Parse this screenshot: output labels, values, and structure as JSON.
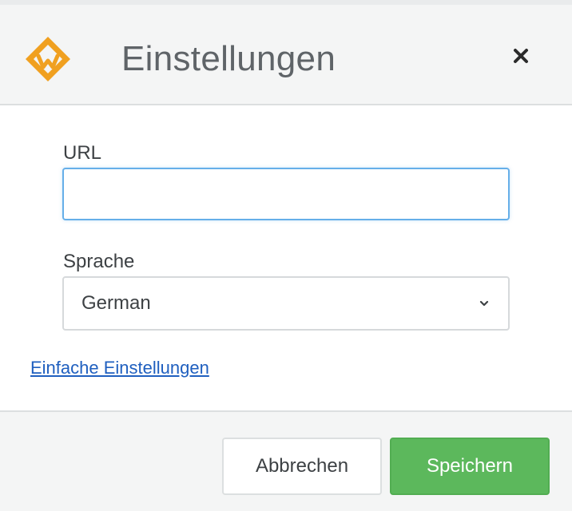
{
  "dialog": {
    "title": "Einstellungen",
    "logo_icon": "brand-logo-icon",
    "close_icon": "close-icon"
  },
  "form": {
    "url": {
      "label": "URL",
      "value": "",
      "placeholder": ""
    },
    "language": {
      "label": "Sprache",
      "selected": "German",
      "icon": "chevron-down-icon"
    },
    "simple_settings_link": "Einfache Einstellungen"
  },
  "footer": {
    "cancel_label": "Abbrechen",
    "save_label": "Speichern"
  },
  "colors": {
    "accent_orange": "#f0a020",
    "save_green": "#5cb85c",
    "focus_blue": "#66afe9",
    "link_blue": "#1f5fbf"
  }
}
